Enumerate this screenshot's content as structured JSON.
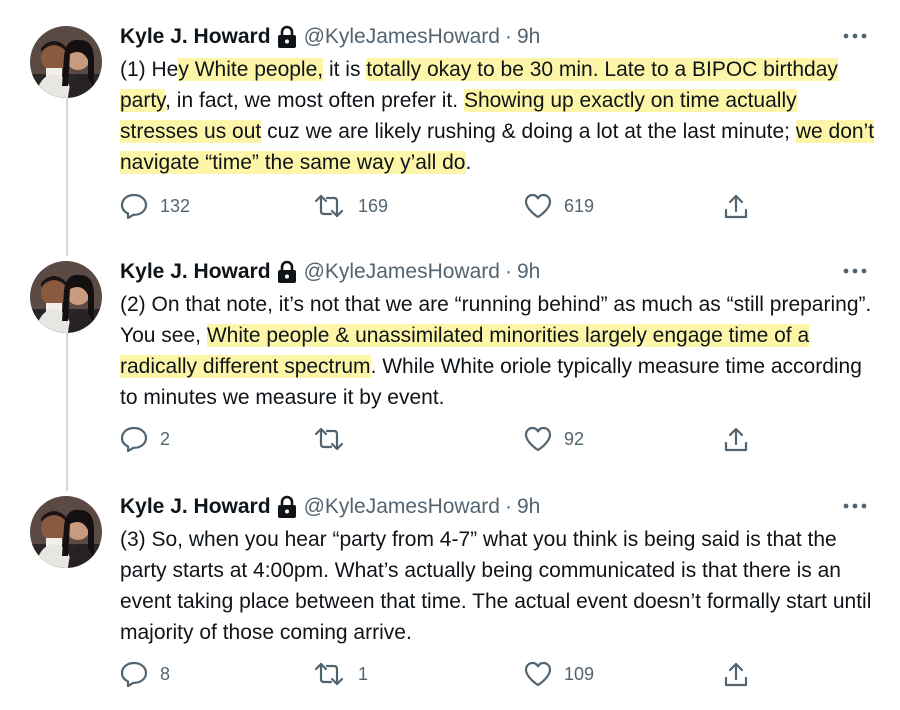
{
  "author": {
    "name": "Kyle J. Howard",
    "handle": "@KyleJamesHoward",
    "separator": "·"
  },
  "tweets": [
    {
      "time": "9h",
      "segments": [
        {
          "text": "(1) He",
          "hl": false
        },
        {
          "text": "y White people,",
          "hl": true
        },
        {
          "text": " it is ",
          "hl": false
        },
        {
          "text": "totally okay to be 30 min. Late to a BIPOC birthday party",
          "hl": true
        },
        {
          "text": ", in fact, we most often prefer it. ",
          "hl": false
        },
        {
          "text": "Showing up exactly on time actually stresses us out",
          "hl": true
        },
        {
          "text": " cuz we are likely rushing & doing a lot at the last minute; ",
          "hl": false
        },
        {
          "text": "we don’t navigate “time” the same way y’all do",
          "hl": true
        },
        {
          "text": ".",
          "hl": false
        }
      ],
      "replies": "132",
      "retweets": "169",
      "likes": "619"
    },
    {
      "time": "9h",
      "segments": [
        {
          "text": "(2) On that note, it’s not that we are “running behind” as much as “still preparing”. You see, ",
          "hl": false
        },
        {
          "text": "White people & unassimilated minorities largely engage time of a radically different spectrum",
          "hl": true
        },
        {
          "text": ". While White oriole typically measure time according to minutes we measure it by event.",
          "hl": false
        }
      ],
      "replies": "2",
      "retweets": "",
      "likes": "92"
    },
    {
      "time": "9h",
      "segments": [
        {
          "text": "(3) So, when you hear “party from 4-7” what you think is being said is that the party starts at 4:00pm. What’s actually being communicated is that there is an event taking place between that time. The actual event doesn’t formally start until majority of those coming arrive.",
          "hl": false
        }
      ],
      "replies": "8",
      "retweets": "1",
      "likes": "109"
    }
  ],
  "icons": {
    "reply": "reply-icon",
    "retweet": "retweet-icon",
    "like": "heart-icon",
    "share": "share-icon",
    "more": "more-icon",
    "lock": "lock-icon"
  },
  "colors": {
    "highlight": "#fdf6a8",
    "text": "#0f1419",
    "secondary": "#536471",
    "thread_line": "#cfd9de"
  }
}
